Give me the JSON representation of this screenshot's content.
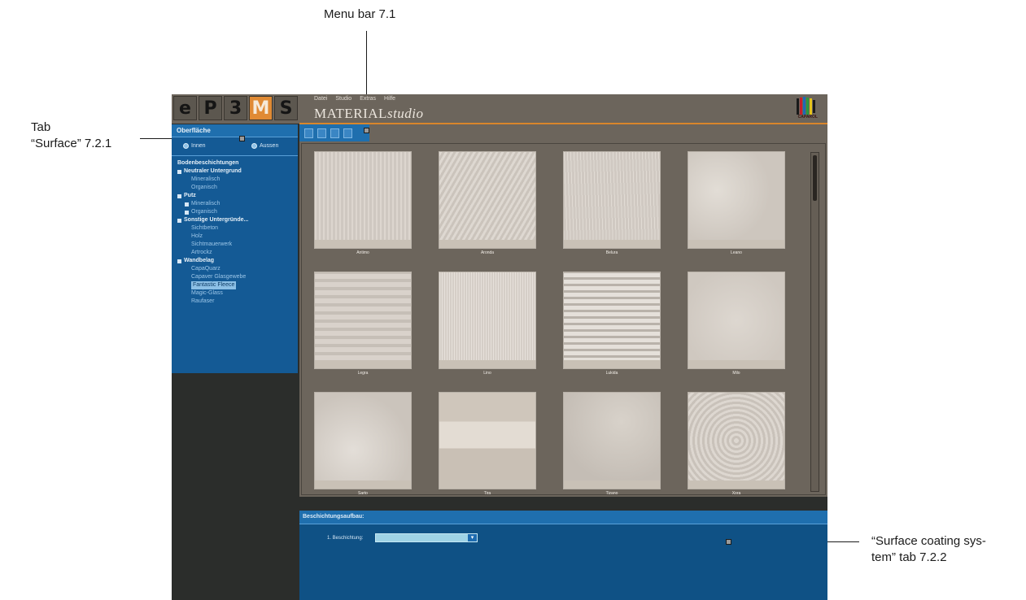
{
  "annotations": {
    "menu_bar": "Menu bar 7.1",
    "tab_surface_line1": "Tab",
    "tab_surface_line2": "“Surface” 7.2.1",
    "coating_line1": "“Surface coating sys-",
    "coating_line2": "tem” tab 7.2.2"
  },
  "logo": {
    "cells": [
      "e",
      "P",
      "3",
      "M",
      "S"
    ],
    "accent_index": 3
  },
  "menu": [
    "Datei",
    "Studio",
    "Extras",
    "Hilfe"
  ],
  "app_title": {
    "main": "MATERIAL",
    "italic": "studio"
  },
  "brand": "CAPAROL",
  "sidebar": {
    "tab_title": "Oberfläche",
    "radio_inside": "Innen",
    "radio_outside": "Aussen",
    "tree": [
      {
        "label": "Bodenbeschichtungen",
        "kind": "header",
        "box": false
      },
      {
        "label": "Neutraler Untergrund",
        "kind": "header",
        "box": true
      },
      {
        "label": "Mineralisch",
        "kind": "sub",
        "box": false
      },
      {
        "label": "Organisch",
        "kind": "sub",
        "box": false
      },
      {
        "label": "Putz",
        "kind": "header",
        "box": true
      },
      {
        "label": "Mineralisch",
        "kind": "sub",
        "box": true
      },
      {
        "label": "Organisch",
        "kind": "sub",
        "box": true
      },
      {
        "label": "Sonstige Untergründe...",
        "kind": "header",
        "box": true
      },
      {
        "label": "Sichtbeton",
        "kind": "sub",
        "box": false
      },
      {
        "label": "Holz",
        "kind": "sub",
        "box": false
      },
      {
        "label": "Sichtmauerwerk",
        "kind": "sub",
        "box": false
      },
      {
        "label": "Artrockz",
        "kind": "sub",
        "box": false
      },
      {
        "label": "Wandbelag",
        "kind": "header",
        "box": true
      },
      {
        "label": "CapaQuarz",
        "kind": "sub",
        "box": false
      },
      {
        "label": "Capaver Glasgewebe",
        "kind": "sub",
        "box": false
      },
      {
        "label": "Fantastic Fleece",
        "kind": "sub",
        "box": false,
        "selected": true
      },
      {
        "label": "Magic-Glass",
        "kind": "sub",
        "box": false
      },
      {
        "label": "Raufaser",
        "kind": "sub",
        "box": false
      }
    ]
  },
  "toolbar": {
    "icons": [
      "new-file-icon",
      "open-icon",
      "save-icon",
      "print-icon"
    ]
  },
  "materials": [
    "Antimo",
    "Aronda",
    "Belura",
    "Leano",
    "Legra",
    "Lino",
    "Lukida",
    "Milo",
    "Sarto",
    "Tira",
    "Tizano",
    "Xora"
  ],
  "coating": {
    "tab_title": "Beschichtungsaufbau:",
    "label": "1. Beschichtung:",
    "value": ""
  },
  "colors": {
    "accent": "#e08a34",
    "panel_blue": "#145a95",
    "header_brown": "#6c655c"
  }
}
